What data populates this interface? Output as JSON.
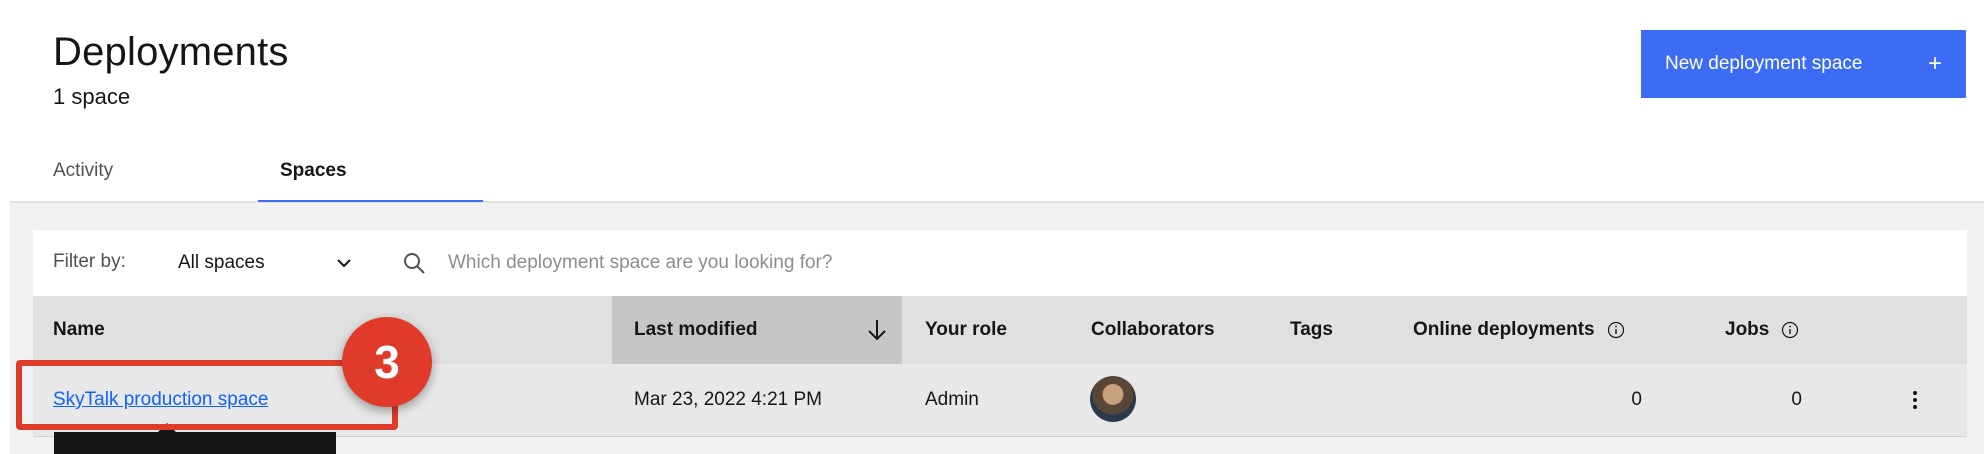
{
  "header": {
    "title": "Deployments",
    "subtitle": "1 space",
    "new_button_label": "New deployment space",
    "new_button_icon": "+"
  },
  "tabs": [
    {
      "label": "Activity",
      "selected": false
    },
    {
      "label": "Spaces",
      "selected": true
    }
  ],
  "filter": {
    "label": "Filter by:",
    "selected": "All spaces",
    "search_placeholder": "Which deployment space are you looking for?"
  },
  "table": {
    "columns": {
      "name": "Name",
      "last_modified": "Last modified",
      "role": "Your role",
      "collaborators": "Collaborators",
      "tags": "Tags",
      "online_deployments": "Online deployments",
      "jobs": "Jobs"
    },
    "sort": {
      "column": "Last modified",
      "direction": "descending"
    },
    "rows": [
      {
        "name": "SkyTalk production space",
        "last_modified": "Mar 23, 2022 4:21 PM",
        "role": "Admin",
        "tags": "",
        "online_deployments": "0",
        "jobs": "0"
      }
    ]
  },
  "annotation": {
    "step": "3"
  },
  "colors": {
    "primary": "#3d6cf4",
    "annotation": "#e03a2a",
    "link": "#0f62fe"
  }
}
